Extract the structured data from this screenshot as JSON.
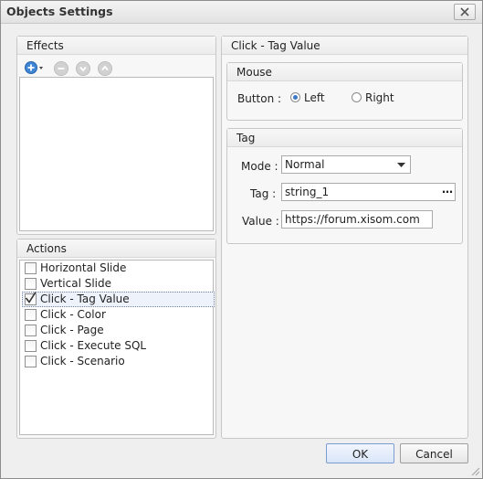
{
  "window": {
    "title": "Objects Settings"
  },
  "effects": {
    "header": "Effects"
  },
  "actions": {
    "header": "Actions",
    "items": [
      {
        "label": "Horizontal Slide",
        "checked": false
      },
      {
        "label": "Vertical Slide",
        "checked": false
      },
      {
        "label": "Click - Tag Value",
        "checked": true,
        "selected": true
      },
      {
        "label": "Click - Color",
        "checked": false
      },
      {
        "label": "Click - Page",
        "checked": false
      },
      {
        "label": "Click - Execute SQL",
        "checked": false
      },
      {
        "label": "Click - Scenario",
        "checked": false
      }
    ]
  },
  "detail": {
    "header": "Click - Tag Value",
    "mouse": {
      "header": "Mouse",
      "button_label": "Button :",
      "left_label": "Left",
      "right_label": "Right",
      "selected": "Left"
    },
    "tag": {
      "header": "Tag",
      "mode_label": "Mode :",
      "mode_value": "Normal",
      "tag_label": "Tag :",
      "tag_value": "string_1",
      "browse_label": "…",
      "value_label": "Value :",
      "value_value": "https://forum.xisom.com"
    }
  },
  "footer": {
    "ok_label": "OK",
    "cancel_label": "Cancel"
  },
  "colors": {
    "accent": "#3b79c6",
    "selection": "#eef3fb"
  }
}
